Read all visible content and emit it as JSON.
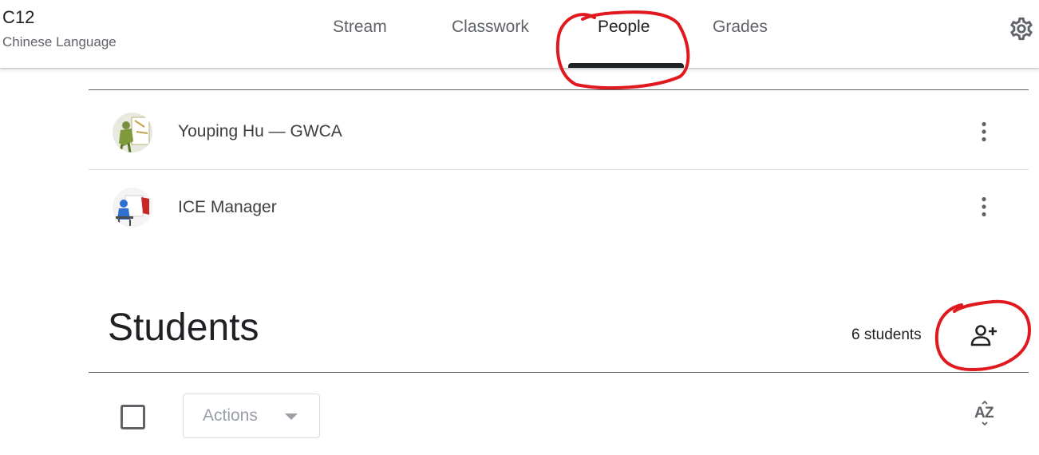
{
  "header": {
    "class_name": "C12",
    "class_subject": "Chinese Language",
    "tabs": [
      {
        "label": "Stream",
        "active": false
      },
      {
        "label": "Classwork",
        "active": false
      },
      {
        "label": "People",
        "active": true
      },
      {
        "label": "Grades",
        "active": false
      }
    ],
    "settings_icon": "gear-icon"
  },
  "teachers": [
    {
      "name": "Youping Hu — GWCA",
      "avatar": "photo-avatar",
      "menu_icon": "more-vert-icon"
    },
    {
      "name": "ICE Manager",
      "avatar": "photo-avatar",
      "menu_icon": "more-vert-icon"
    }
  ],
  "students": {
    "heading": "Students",
    "count_label": "6 students",
    "invite_icon": "person-add-icon",
    "actions_label": "Actions",
    "sort_icon": "sort-az-icon"
  },
  "colors": {
    "text_primary": "#202124",
    "text_secondary": "#5f6368",
    "divider": "#dadce0",
    "annotation_red": "#e0191f"
  }
}
